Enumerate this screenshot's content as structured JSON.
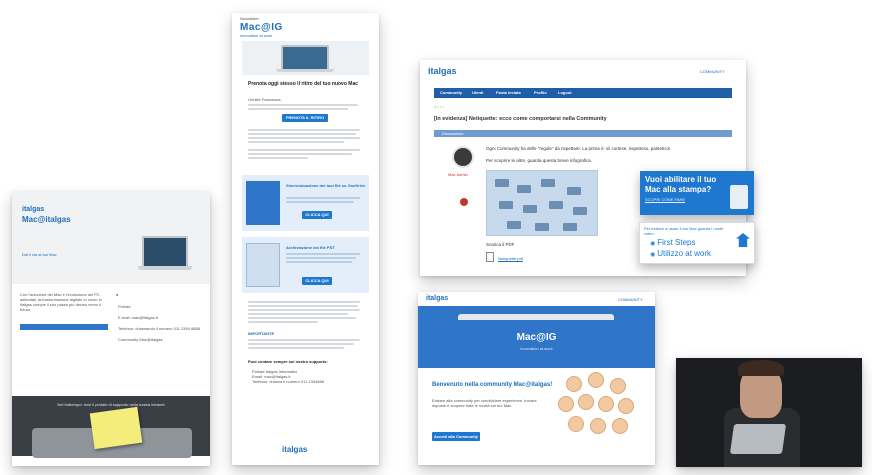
{
  "panel1": {
    "logo": "italgas",
    "title": "Mac@italgas",
    "tagline": "Dai il via al tuo Mac",
    "body": "Con l'adozione del Mac e l'evoluzione dei PC aziendali, la trasformazione digitale in corso in Italgas compie il suo passo più deciso verso il futuro.",
    "note": "Nel frattempo: trovi il portale di supporto nella nostra intranet",
    "contacts": [
      "Portale",
      "E-mail: mac@italgas.it",
      "Telefono: chiamando il numero 011 2394 8888",
      "Community Mac@italgas"
    ]
  },
  "panel2": {
    "header": "Newsletter",
    "logo": "Mac@IG",
    "logo_sub": "innovation at work",
    "headline": "Prenota oggi stesso il ritiro del tuo nuovo Mac",
    "intro": "Gentile Francesca,",
    "btn_primary": "PRENOTA IL RITIRO",
    "card1_title": "Sincronizzazione dei tuoi file su OneDrive",
    "card1_btn": "CLICCA QUI",
    "card2_title": "Archiviazione dei file PST",
    "card2_btn": "CLICCA QUI",
    "important": "IMPORTANTE",
    "support_title": "Puoi contare sempre sul nostro supporto:",
    "support_items": [
      "Portale Italgas Informatici",
      "Email: mac@italgas.it",
      "Telefono: chiama il numero 011 2394888"
    ],
    "footer_logo": "italgas"
  },
  "panel3": {
    "logo": "italgas",
    "top_link": "COMMUNITY",
    "nav": [
      "Community",
      "Utenti",
      "Posta inviata",
      "Profilo",
      "Logout"
    ],
    "title": "[In evidenza] Netiquette: ecco come comportarsi nella Community",
    "section": "Discussione",
    "post_text": "Ogni Community ha delle \"regole\" da rispettare. La prima è: sii cortese, rispettoso, paritetico!",
    "post_sub": "Per scoprire le altre, guarda questa breve infografica.",
    "author": "Mac Admin",
    "file_title": "Scarica il PDF",
    "file_name": "Netiquette.pdf"
  },
  "callout1": {
    "title": "Vuoi abilitare il tuo Mac alla stampa?",
    "link": "SCOPRI COME FARE"
  },
  "callout2": {
    "heading": "Per iniziare a usare il tuo Mac guarda i nostri video:",
    "items": [
      "First Steps",
      "Utilizzo at work"
    ]
  },
  "panel4": {
    "logo": "italgas",
    "top_link": "COMMUNITY",
    "brand": "Mac@IG",
    "brand_sub": "innovation at work",
    "welcome": "Benvenuto nella community Mac@italgas!",
    "body": "Entrare alla community per condividere esperienze, trovare risposte e scoprire tutte le novità sul tuo Mac.",
    "button": "Accedi alla Community"
  },
  "colors": {
    "brand_blue": "#1e6fb8",
    "accent_blue": "#1e78d0",
    "nav_blue": "#1f5fa8",
    "note_yellow": "#f4ec7b"
  }
}
